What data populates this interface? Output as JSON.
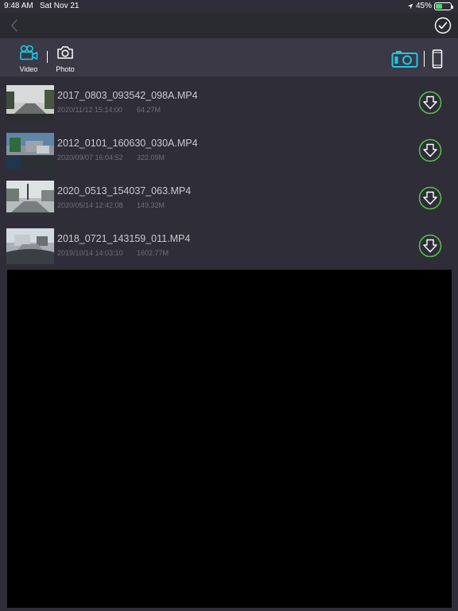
{
  "status_bar": {
    "time": "9:48 AM",
    "date": "Sat Nov 21",
    "battery": "45%",
    "battery_level": 0.45
  },
  "nav": {
    "back_icon": "chevron-left-icon",
    "confirm_icon": "check-circle-icon"
  },
  "tabs": {
    "video_label": "Video",
    "photo_label": "Photo",
    "active": "video"
  },
  "source": {
    "camera_icon": "dashcam-icon",
    "phone_icon": "phone-icon",
    "active": "camera"
  },
  "colors": {
    "accent": "#1ec8e6",
    "download": "#58c247",
    "background": "#2f2e38"
  },
  "files": [
    {
      "name": "2017_0803_093542_098A.MP4",
      "date": "2020/11/12 15:14:00",
      "size": "64.27M"
    },
    {
      "name": "2012_0101_160630_030A.MP4",
      "date": "2020/09/07 16:04:52",
      "size": "322.09M"
    },
    {
      "name": "2020_0513_154037_063.MP4",
      "date": "2020/05/14 12:42:08",
      "size": "149.32M"
    },
    {
      "name": "2018_0721_143159_011.MP4",
      "date": "2019/10/14 14:03:10",
      "size": "1602.77M"
    }
  ]
}
